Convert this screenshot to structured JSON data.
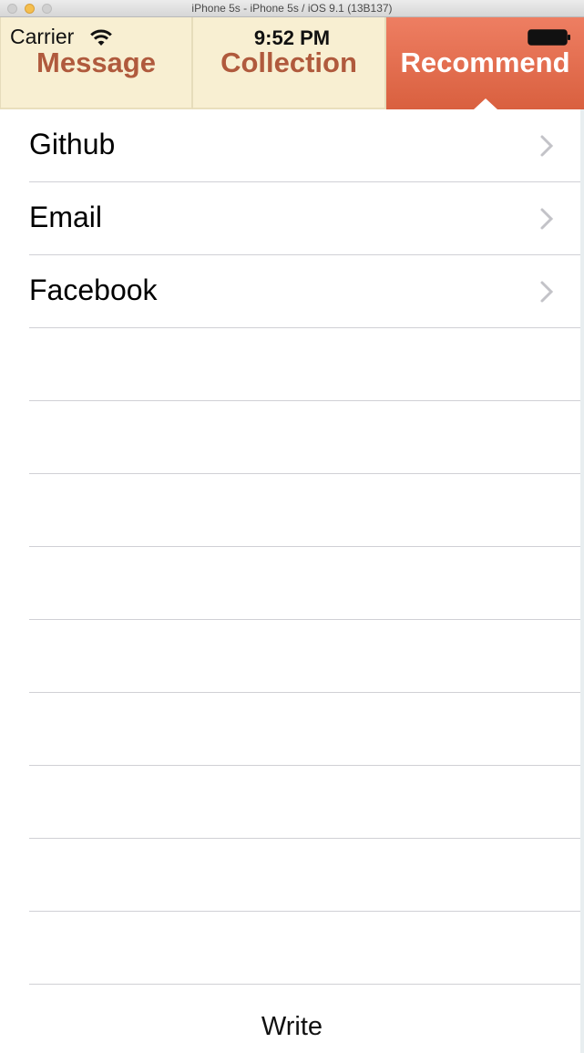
{
  "window": {
    "title": "iPhone 5s - iPhone 5s / iOS 9.1 (13B137)"
  },
  "status_bar": {
    "carrier": "Carrier",
    "time": "9:52 PM",
    "wifi_icon": "wifi-icon",
    "battery_icon": "battery-icon"
  },
  "menu": {
    "tabs": [
      {
        "label": "Message",
        "selected": false
      },
      {
        "label": "Collection",
        "selected": false
      },
      {
        "label": "Recommend",
        "selected": true
      }
    ],
    "colors": {
      "tab_background": "#f8efd2",
      "tab_text": "#b05a3d",
      "selected_background": "#e5694b",
      "selected_text": "#ffffff"
    }
  },
  "list": {
    "items": [
      {
        "label": "Github",
        "icon": "chevron-right-icon"
      },
      {
        "label": "Email",
        "icon": "chevron-right-icon"
      },
      {
        "label": "Facebook",
        "icon": "chevron-right-icon"
      }
    ]
  },
  "footer": {
    "write_label": "Write"
  }
}
